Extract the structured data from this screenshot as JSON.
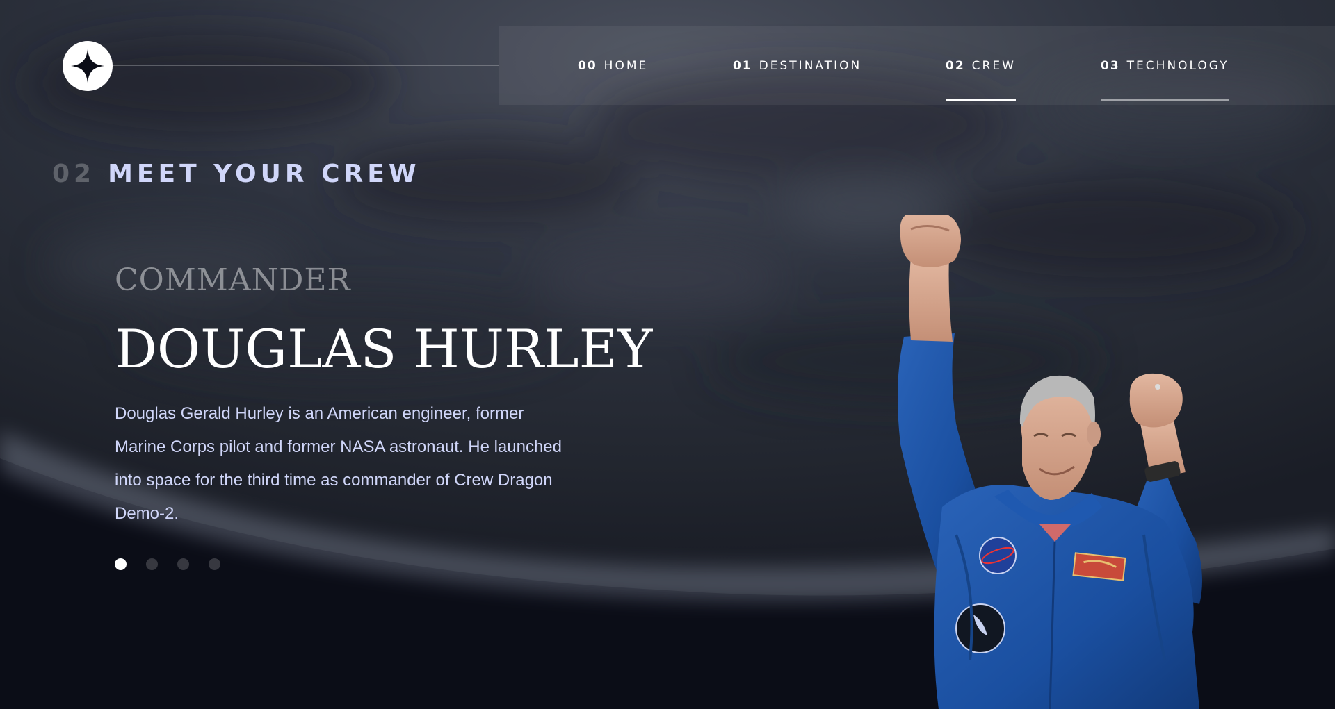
{
  "nav": {
    "items": [
      {
        "num": "00",
        "label": "HOME"
      },
      {
        "num": "01",
        "label": "DESTINATION"
      },
      {
        "num": "02",
        "label": "CREW"
      },
      {
        "num": "03",
        "label": "TECHNOLOGY"
      }
    ],
    "active_index": 2
  },
  "page_heading": {
    "num": "02",
    "title": "MEET YOUR CREW"
  },
  "crew": {
    "role": "COMMANDER",
    "name": "DOUGLAS HURLEY",
    "bio": "Douglas Gerald Hurley is an American engineer, former Marine Corps pilot and former NASA astronaut. He launched into space for the third time as commander of Crew Dragon Demo-2."
  },
  "pagination": {
    "count": 4,
    "active_index": 0
  },
  "icons": {
    "logo": "four-point-star-icon"
  },
  "colors": {
    "background": "#0b0d17",
    "accent": "#d0d6f9",
    "suit": "#1a4fa0"
  }
}
